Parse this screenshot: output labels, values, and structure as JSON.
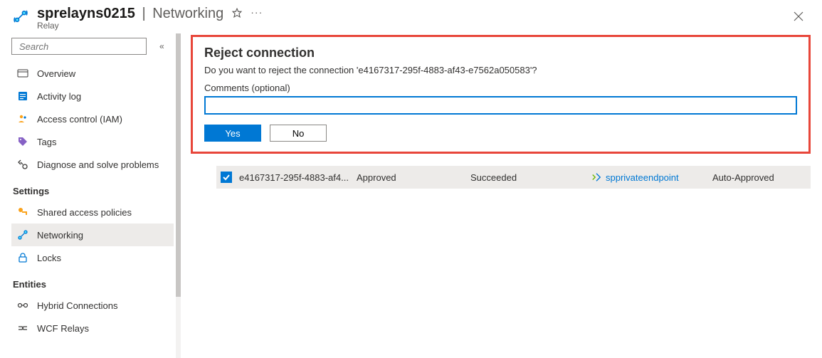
{
  "header": {
    "resource_name": "sprelayns0215",
    "section": "Networking",
    "subtitle": "Relay"
  },
  "sidebar": {
    "search_placeholder": "Search",
    "items": {
      "overview": "Overview",
      "activity_log": "Activity log",
      "access_control": "Access control (IAM)",
      "tags": "Tags",
      "diagnose": "Diagnose and solve problems"
    },
    "settings_header": "Settings",
    "settings": {
      "shared_access": "Shared access policies",
      "networking": "Networking",
      "locks": "Locks"
    },
    "entities_header": "Entities",
    "entities": {
      "hybrid": "Hybrid Connections",
      "wcf": "WCF Relays"
    }
  },
  "dialog": {
    "title": "Reject connection",
    "message": "Do you want to reject the connection 'e4167317-295f-4883-af43-e7562a050583'?",
    "comments_label": "Comments (optional)",
    "comments_value": "",
    "yes": "Yes",
    "no": "No"
  },
  "table": {
    "rows": [
      {
        "connection": "e4167317-295f-4883-af4...",
        "state": "Approved",
        "provisioning": "Succeeded",
        "endpoint": "spprivateendpoint",
        "description": "Auto-Approved",
        "checked": true
      }
    ]
  }
}
